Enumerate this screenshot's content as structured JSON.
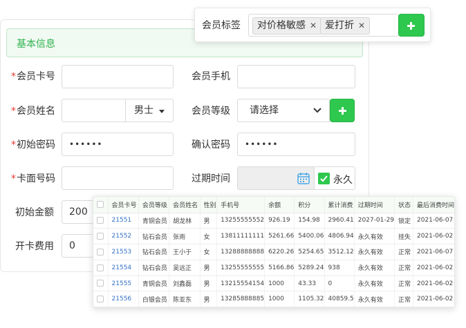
{
  "section_title": "基本信息",
  "labels": {
    "card_no": "会员卡号",
    "phone": "会员手机",
    "name": "会员姓名",
    "level": "会员等级",
    "init_pwd": "初始密码",
    "confirm_pwd": "确认密码",
    "face_no": "卡面号码",
    "expire": "过期时间",
    "init_amount": "初始金额",
    "card_fee": "开卡费用"
  },
  "required_mark": "*",
  "fields": {
    "gender": "男士",
    "level_placeholder": "请选择",
    "init_pwd": "••••••",
    "confirm_pwd": "••••••",
    "init_amount": "200",
    "card_fee": "0",
    "forever_label": "永久"
  },
  "tags": {
    "label": "会员标签",
    "items": [
      "对价格敏感",
      "爱打折"
    ],
    "remove_glyph": "✕"
  },
  "table": {
    "headers": [
      "会员卡号",
      "会员等级",
      "会员姓名",
      "性别",
      "手机号",
      "余额",
      "积分",
      "累计消费",
      "过期时间",
      "状态",
      "最后消费时间"
    ],
    "rows": [
      [
        "21551",
        "青铜会员",
        "胡龙林",
        "男",
        "13255555552",
        "926.19",
        "154.98",
        "2960.41",
        "2027-01-29",
        "锁定",
        "2021-06-07"
      ],
      [
        "21552",
        "钻石会员",
        "张雨",
        "女",
        "13811111111",
        "5261.66",
        "5400.06",
        "4806.94",
        "永久有效",
        "挂失",
        "2021-06-02"
      ],
      [
        "21553",
        "钻石会员",
        "王小于",
        "女",
        "13288888888",
        "6220.26",
        "5254.65",
        "3512.12",
        "永久有效",
        "正常",
        "2021-06-07"
      ],
      [
        "21554",
        "钻石会员",
        "吴远正",
        "男",
        "13255555555",
        "5166.86",
        "5289.24",
        "938",
        "永久有效",
        "正常",
        "2021-06-02"
      ],
      [
        "21555",
        "青铜会员",
        "刘鑫磊",
        "男",
        "13215554154",
        "1000",
        "43.33",
        "0",
        "永久有效",
        "正常",
        "2021-06-02"
      ],
      [
        "21556",
        "白银会员",
        "陈亚东",
        "男",
        "13285888885",
        "1000",
        "1105.32",
        "40859.5",
        "永久有效",
        "正常",
        "2021-06-02"
      ]
    ]
  },
  "colors": {
    "accent": "#2ec84f",
    "required": "#e53935",
    "link": "#3070c8"
  }
}
